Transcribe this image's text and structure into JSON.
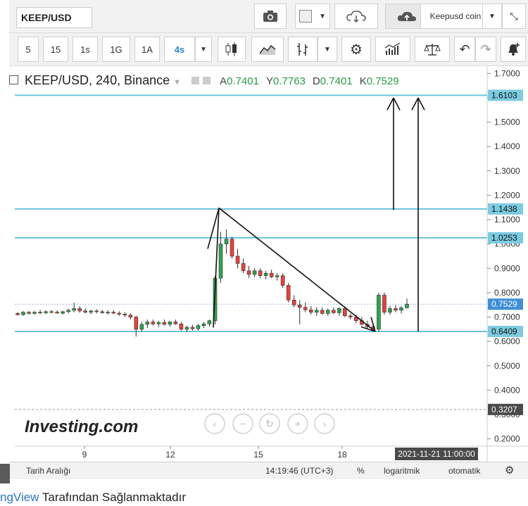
{
  "toolbar": {
    "symbol": "KEEP/USD",
    "timeframes": [
      "5",
      "15",
      "1s",
      "1G",
      "1A",
      "4s"
    ],
    "active_timeframe": "4s",
    "user_label": "Keepusd coin",
    "icons": [
      "camera-icon",
      "color-box-icon",
      "cloud-download-icon",
      "cloud-upload-icon",
      "candles-icon",
      "line-chart-icon",
      "bars-icon",
      "settings-gear-icon",
      "indicators-icon",
      "scale-icon",
      "undo-icon",
      "redo-icon",
      "alert-bell-icon"
    ]
  },
  "legend": {
    "title": "KEEP/USD, 240, Binance",
    "o_label": "A",
    "o_value": "0.7401",
    "h_label": "Y",
    "h_value": "0.7763",
    "l_label": "D",
    "l_value": "0.7401",
    "c_label": "K",
    "c_value": "0.7529"
  },
  "bottom_bar": {
    "range_label": "Tarih Aralığı",
    "time": "14:19:46 (UTC+3)",
    "percent": "%",
    "log": "logaritmik",
    "auto": "otomatik"
  },
  "caption": {
    "link": "ngView",
    "rest": " Tarafından Sağlanmaktadır"
  },
  "watermark": "Investing.com",
  "zoom_controls": [
    "‹",
    "−",
    "↻",
    "+",
    "›"
  ],
  "crosshair_date": "2021-11-21 11:00:00",
  "colors": {
    "up": "#2ea44f",
    "down": "#e5423f",
    "hline": "#6cc3d9",
    "label_bg": "#7ccbe0",
    "current_bg": "#3f8fd8",
    "crosshair_bg": "#4a4a4a"
  },
  "chart_data": {
    "type": "candlestick",
    "y_ticks": [
      "1.7000",
      "1.6000",
      "1.5000",
      "1.4000",
      "1.3000",
      "1.2000",
      "1.1000",
      "1.0000",
      "0.9000",
      "0.8000",
      "0.7000",
      "0.6000",
      "0.5000",
      "0.4000",
      "0.3000",
      "0.2000"
    ],
    "x_ticks": [
      "9",
      "12",
      "15",
      "18"
    ],
    "ylim": [
      0.17,
      1.73
    ],
    "horizontal_levels": [
      "1.6103",
      "1.1438",
      "1.0253",
      "0.6409"
    ],
    "current_price": "0.7529",
    "crosshair_price": "0.3207",
    "candles": [
      [
        0.715,
        0.72,
        0.705,
        0.71
      ],
      [
        0.71,
        0.725,
        0.705,
        0.72
      ],
      [
        0.72,
        0.725,
        0.71,
        0.715
      ],
      [
        0.715,
        0.725,
        0.71,
        0.72
      ],
      [
        0.72,
        0.73,
        0.712,
        0.718
      ],
      [
        0.718,
        0.728,
        0.712,
        0.722
      ],
      [
        0.722,
        0.73,
        0.715,
        0.72
      ],
      [
        0.72,
        0.728,
        0.714,
        0.716
      ],
      [
        0.716,
        0.726,
        0.71,
        0.722
      ],
      [
        0.722,
        0.735,
        0.715,
        0.728
      ],
      [
        0.728,
        0.76,
        0.72,
        0.735
      ],
      [
        0.735,
        0.745,
        0.718,
        0.725
      ],
      [
        0.725,
        0.735,
        0.715,
        0.72
      ],
      [
        0.72,
        0.73,
        0.712,
        0.725
      ],
      [
        0.725,
        0.732,
        0.715,
        0.722
      ],
      [
        0.722,
        0.73,
        0.714,
        0.718
      ],
      [
        0.718,
        0.728,
        0.71,
        0.72
      ],
      [
        0.72,
        0.728,
        0.712,
        0.716
      ],
      [
        0.716,
        0.724,
        0.705,
        0.712
      ],
      [
        0.712,
        0.72,
        0.7,
        0.708
      ],
      [
        0.708,
        0.715,
        0.69,
        0.7
      ],
      [
        0.7,
        0.705,
        0.62,
        0.65
      ],
      [
        0.65,
        0.68,
        0.64,
        0.67
      ],
      [
        0.67,
        0.69,
        0.655,
        0.68
      ],
      [
        0.68,
        0.69,
        0.665,
        0.672
      ],
      [
        0.672,
        0.685,
        0.66,
        0.678
      ],
      [
        0.678,
        0.69,
        0.665,
        0.67
      ],
      [
        0.67,
        0.685,
        0.66,
        0.68
      ],
      [
        0.68,
        0.69,
        0.668,
        0.672
      ],
      [
        0.672,
        0.68,
        0.645,
        0.65
      ],
      [
        0.65,
        0.665,
        0.64,
        0.658
      ],
      [
        0.658,
        0.668,
        0.645,
        0.652
      ],
      [
        0.652,
        0.672,
        0.645,
        0.665
      ],
      [
        0.665,
        0.68,
        0.655,
        0.672
      ],
      [
        0.672,
        0.69,
        0.66,
        0.685
      ],
      [
        0.685,
        0.87,
        0.67,
        0.86
      ],
      [
        0.86,
        1.05,
        0.84,
        1.0
      ],
      [
        1.0,
        1.06,
        0.96,
        1.02
      ],
      [
        1.02,
        1.03,
        0.94,
        0.95
      ],
      [
        0.95,
        0.98,
        0.9,
        0.92
      ],
      [
        0.92,
        0.94,
        0.88,
        0.89
      ],
      [
        0.89,
        0.91,
        0.86,
        0.875
      ],
      [
        0.875,
        0.9,
        0.865,
        0.89
      ],
      [
        0.89,
        0.9,
        0.86,
        0.87
      ],
      [
        0.87,
        0.89,
        0.855,
        0.88
      ],
      [
        0.88,
        0.895,
        0.86,
        0.865
      ],
      [
        0.865,
        0.88,
        0.85,
        0.87
      ],
      [
        0.87,
        0.88,
        0.82,
        0.83
      ],
      [
        0.83,
        0.84,
        0.76,
        0.77
      ],
      [
        0.77,
        0.79,
        0.74,
        0.75
      ],
      [
        0.75,
        0.77,
        0.67,
        0.74
      ],
      [
        0.74,
        0.76,
        0.72,
        0.73
      ],
      [
        0.73,
        0.745,
        0.71,
        0.72
      ],
      [
        0.72,
        0.74,
        0.705,
        0.728
      ],
      [
        0.728,
        0.74,
        0.71,
        0.715
      ],
      [
        0.715,
        0.735,
        0.705,
        0.728
      ],
      [
        0.728,
        0.74,
        0.712,
        0.718
      ],
      [
        0.718,
        0.74,
        0.705,
        0.735
      ],
      [
        0.735,
        0.745,
        0.7,
        0.705
      ],
      [
        0.705,
        0.715,
        0.69,
        0.7
      ],
      [
        0.7,
        0.71,
        0.675,
        0.685
      ],
      [
        0.685,
        0.7,
        0.665,
        0.67
      ],
      [
        0.67,
        0.685,
        0.65,
        0.66
      ],
      [
        0.66,
        0.675,
        0.64,
        0.65
      ],
      [
        0.65,
        0.8,
        0.64,
        0.79
      ],
      [
        0.79,
        0.8,
        0.71,
        0.72
      ],
      [
        0.72,
        0.745,
        0.71,
        0.735
      ],
      [
        0.735,
        0.75,
        0.72,
        0.728
      ],
      [
        0.728,
        0.745,
        0.715,
        0.738
      ],
      [
        0.738,
        0.776,
        0.735,
        0.753
      ]
    ]
  }
}
